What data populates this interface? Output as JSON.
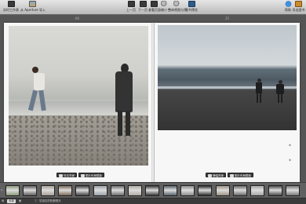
{
  "toolbar": {
    "left_buttons": [
      {
        "label": "实时工作表",
        "icon": "monitor-icon"
      },
      {
        "label": "从 Aperture 导入",
        "icon": "photo-import-icon"
      }
    ],
    "center_buttons": [
      {
        "label": "上一页",
        "icon": "previous-page-icon"
      },
      {
        "label": "下一页",
        "icon": "next-page-icon"
      },
      {
        "label": "查看页面",
        "icon": "view-page-icon"
      },
      {
        "label": "缩小",
        "icon": "zoom-out-icon"
      },
      {
        "label": "整体视图与列",
        "icon": "zoom-in-icon"
      },
      {
        "label": "图书预览",
        "icon": "book-preview-icon"
      }
    ],
    "right_buttons": [
      {
        "label": "帮助",
        "icon": "help-icon"
      },
      {
        "label": "导出图书",
        "icon": "export-icon"
      }
    ]
  },
  "pages": {
    "left_number": "66",
    "right_number": "25",
    "right_page_decoration": "◆",
    "left_controls": [
      "设定背景",
      "图片布局模板"
    ],
    "right_controls": [
      "横幅背景",
      "图片布局模板"
    ]
  },
  "filmstrip": {
    "thumb_count": 17
  },
  "statusbar": {
    "button_label": "全部",
    "text": "您选定的相册照片"
  }
}
